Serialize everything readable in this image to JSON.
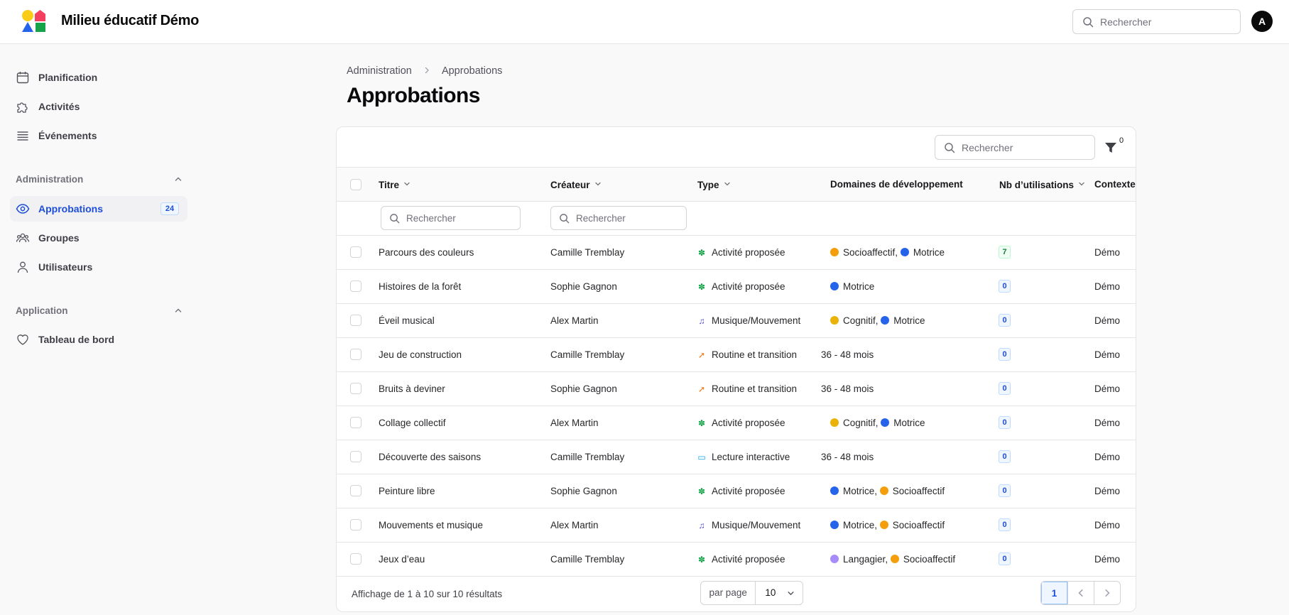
{
  "app": {
    "title": "Milieu éducatif Démo",
    "avatar_initial": "A"
  },
  "header": {
    "search_placeholder": "Rechercher"
  },
  "sidebar": {
    "items": [
      {
        "label": "Planification",
        "icon": "calendar-icon"
      },
      {
        "label": "Activités",
        "icon": "puzzle-icon"
      },
      {
        "label": "Événements",
        "icon": "list-icon"
      }
    ],
    "sections": [
      {
        "title": "Administration",
        "items": [
          {
            "label": "Approbations",
            "icon": "eye-icon",
            "badge": "24",
            "active": true
          },
          {
            "label": "Groupes",
            "icon": "users-icon"
          },
          {
            "label": "Utilisateurs",
            "icon": "user-icon"
          }
        ]
      },
      {
        "title": "Application",
        "items": [
          {
            "label": "Tableau de bord",
            "icon": "heart-icon"
          }
        ]
      }
    ]
  },
  "breadcrumb": {
    "parent": "Administration",
    "current": "Approbations"
  },
  "page": {
    "title": "Approbations"
  },
  "table": {
    "search_placeholder": "Rechercher",
    "filter_count": "0",
    "columns": {
      "title": "Titre",
      "creator": "Créateur",
      "type": "Type",
      "domains": "Domaines de développement",
      "uses": "Nb d’utilisations",
      "context": "Contexte"
    },
    "column_search_placeholder": "Rechercher",
    "rows": [
      {
        "title": "Parcours des couleurs",
        "creator": "Camille Tremblay",
        "type": "Activité proposée",
        "type_icon": "puzzle-icon",
        "domains": "Socioaffectif,  Motrice",
        "uses": "7",
        "uses_style": "green",
        "context": "Démo"
      },
      {
        "title": "Histoires de la forêt",
        "creator": "Sophie Gagnon",
        "type": "Activité proposée",
        "type_icon": "puzzle-icon",
        "domains": "Motrice",
        "uses": "0",
        "uses_style": "blue",
        "context": "Démo"
      },
      {
        "title": "Éveil musical",
        "creator": "Alex Martin",
        "type": "Musique/Mouvement",
        "type_icon": "music-note-icon",
        "domains": "Cognitif,  Motrice",
        "uses": "0",
        "uses_style": "blue",
        "context": "Démo"
      },
      {
        "title": "Jeu de construction",
        "creator": "Camille Tremblay",
        "type": "Routine et transition",
        "type_icon": "transition-icon",
        "domains": "36 - 48 mois",
        "uses": "0",
        "uses_style": "blue",
        "context": "Démo"
      },
      {
        "title": "Bruits à deviner",
        "creator": "Sophie Gagnon",
        "type": "Routine et transition",
        "type_icon": "transition-icon",
        "domains": "36 - 48 mois",
        "uses": "0",
        "uses_style": "blue",
        "context": "Démo"
      },
      {
        "title": "Collage collectif",
        "creator": "Alex Martin",
        "type": "Activité proposée",
        "type_icon": "puzzle-icon",
        "domains": "Cognitif,  Motrice",
        "uses": "0",
        "uses_style": "blue",
        "context": "Démo"
      },
      {
        "title": "Découverte des saisons",
        "creator": "Camille Tremblay",
        "type": "Lecture interactive",
        "type_icon": "book-icon",
        "domains": "36 - 48 mois",
        "uses": "0",
        "uses_style": "blue",
        "context": "Démo"
      },
      {
        "title": "Peinture libre",
        "creator": "Sophie Gagnon",
        "type": "Activité proposée",
        "type_icon": "puzzle-icon",
        "domains": "Motrice,  Socioaffectif",
        "uses": "0",
        "uses_style": "blue",
        "context": "Démo"
      },
      {
        "title": "Mouvements et musique",
        "creator": "Alex Martin",
        "type": "Musique/Mouvement",
        "type_icon": "music-note-icon",
        "domains": "Motrice,  Socioaffectif",
        "uses": "0",
        "uses_style": "blue",
        "context": "Démo"
      },
      {
        "title": "Jeux d’eau",
        "creator": "Camille Tremblay",
        "type": "Activité proposée",
        "type_icon": "puzzle-icon",
        "domains": "Langagier,  Socioaffectif",
        "uses": "0",
        "uses_style": "blue",
        "context": "Démo"
      }
    ]
  },
  "footer": {
    "result_text": "Affichage de 1 à 10 sur 10 résultats",
    "per_page_label": "par page",
    "per_page_value": "10",
    "current_page": "1"
  },
  "colors": {
    "accent": "#1d4ed8",
    "socioaffectif": "#f59e0b",
    "motrice": "#2563eb",
    "cognitif": "#eab308",
    "langagier": "#a78bfa",
    "activite": "#16a34a",
    "musique": "#4f46e5",
    "routine": "#f97316",
    "lecture": "#0ea5e9"
  }
}
